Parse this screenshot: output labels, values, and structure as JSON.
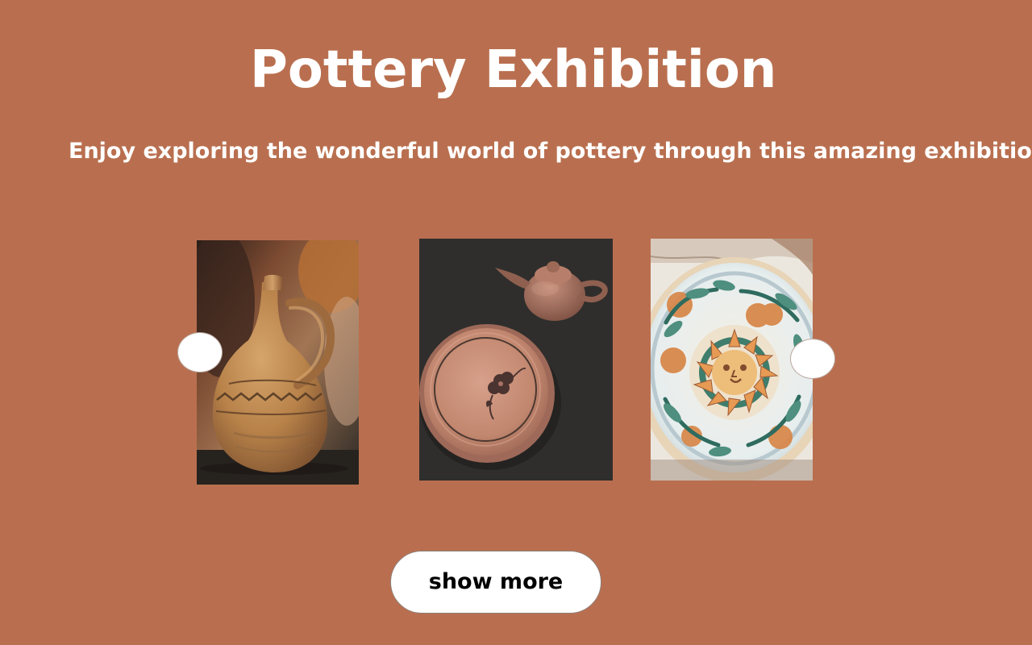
{
  "page": {
    "title": "Pottery Exhibition",
    "subtitle": "Enjoy exploring the wonderful world of pottery through this amazing exhibition"
  },
  "gallery": {
    "images": [
      {
        "name": "clay-jug-photo",
        "alt": ""
      },
      {
        "name": "teapot-and-plate-photo",
        "alt": ""
      },
      {
        "name": "painted-bowl-photo",
        "alt": ""
      }
    ],
    "previous_label": "",
    "next_label": ""
  },
  "actions": {
    "show_more_label": "show more"
  },
  "colors": {
    "background": "#b96f4f",
    "text": "#ffffff",
    "button_background": "#ffffff",
    "button_text": "#000000"
  },
  "icons": {
    "previous": "chevron-left-icon",
    "next": "chevron-right-icon"
  }
}
